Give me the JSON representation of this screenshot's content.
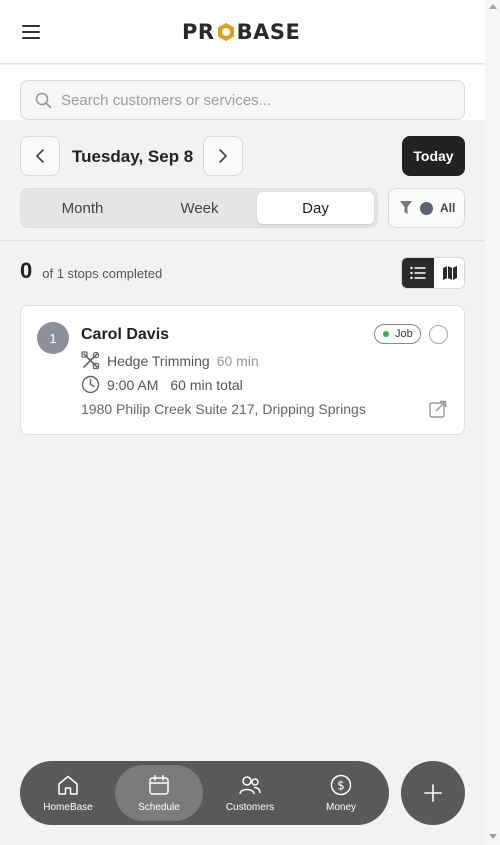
{
  "header": {
    "logo_text_left": "PR",
    "logo_text_right": "BASE",
    "menu_icon": "hamburger-icon"
  },
  "search": {
    "placeholder": "Search customers or services...",
    "value": ""
  },
  "date_nav": {
    "date_label": "Tuesday, Sep 8",
    "today_label": "Today",
    "prev_icon": "chevron-left-icon",
    "next_icon": "chevron-right-icon"
  },
  "view_tabs": {
    "tabs": [
      {
        "label": "Month",
        "active": false
      },
      {
        "label": "Week",
        "active": false
      },
      {
        "label": "Day",
        "active": true
      }
    ]
  },
  "filter": {
    "label": "All",
    "icon": "filter-icon"
  },
  "progress": {
    "completed_count": "0",
    "summary_text": "of 1 stops completed"
  },
  "view_toggle": {
    "list_icon": "list-icon",
    "map_icon": "map-icon",
    "active": "list"
  },
  "stops": [
    {
      "number": "1",
      "customer_name": "Carol Davis",
      "badge": "Job",
      "service": "Hedge Trimming",
      "service_duration": "60 min",
      "time": "9:00 AM",
      "total": "60 min total",
      "address": "1980 Philip Creek Suite 217, Dripping Springs"
    }
  ],
  "bottom_nav": {
    "items": [
      {
        "label": "HomeBase",
        "icon": "home-icon",
        "active": false
      },
      {
        "label": "Schedule",
        "icon": "calendar-icon",
        "active": true
      },
      {
        "label": "Customers",
        "icon": "users-icon",
        "active": false
      },
      {
        "label": "Money",
        "icon": "dollar-icon",
        "active": false
      }
    ],
    "fab_icon": "plus-icon"
  },
  "colors": {
    "brand_dark": "#222222",
    "logo_accent": "#d9a21b",
    "nav_bg": "#595959",
    "job_dot": "#27b35a",
    "stop_number_bg": "#8d9099"
  }
}
